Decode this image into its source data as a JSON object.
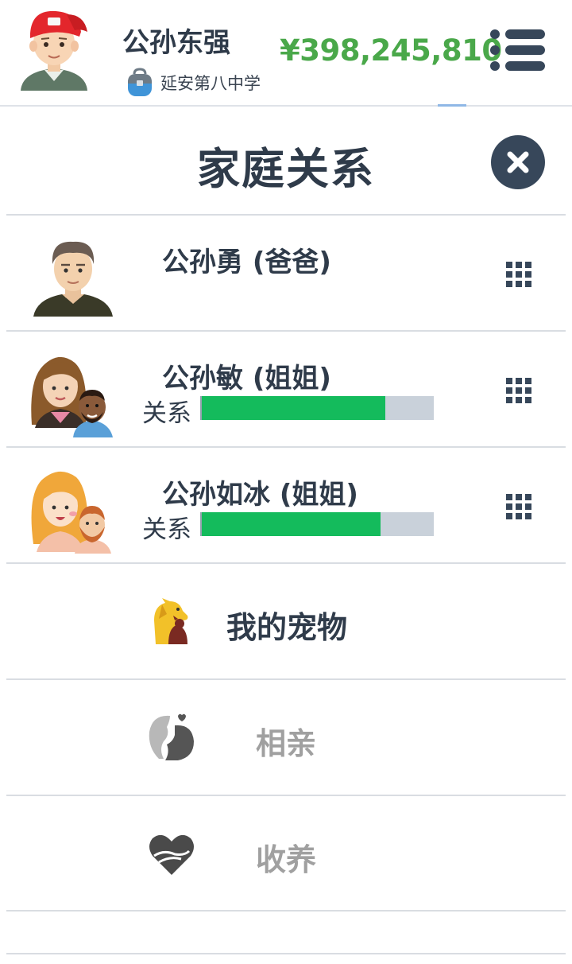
{
  "header": {
    "player_name": "公孙东强",
    "school_name": "延安第八中学",
    "money": "¥398,245,810",
    "avatar": "boy-red-cap-avatar",
    "school_icon": "school-bag-icon",
    "menu_icon": "menu-list-icon"
  },
  "modal": {
    "title": "家庭关系",
    "close_icon": "close-icon"
  },
  "family": [
    {
      "name": "公孙勇 (爸爸)",
      "face_icon": "father-avatar",
      "menu_icon": "grid-icon"
    },
    {
      "name": "公孙敏 (姐姐)",
      "face_icon": "sister-with-partner-avatar",
      "relation_label": "关系",
      "relation_value": 0.79,
      "menu_icon": "grid-icon"
    },
    {
      "name": "公孙如冰 (姐姐)",
      "face_icon": "sister-with-partner-avatar",
      "relation_label": "关系",
      "relation_value": 0.77,
      "menu_icon": "grid-icon"
    }
  ],
  "options": [
    {
      "label": "我的宠物",
      "icon": "pet-dog-icon",
      "enabled": true
    },
    {
      "label": "相亲",
      "icon": "couple-kiss-icon",
      "enabled": false
    },
    {
      "label": "收养",
      "icon": "heart-hug-icon",
      "enabled": false
    }
  ],
  "colors": {
    "money": "#4aa84a",
    "bar_fill": "#14bb5c",
    "bar_bg": "#c9d1da",
    "dark": "#37475a",
    "disabled_text": "#a0a0a0"
  }
}
